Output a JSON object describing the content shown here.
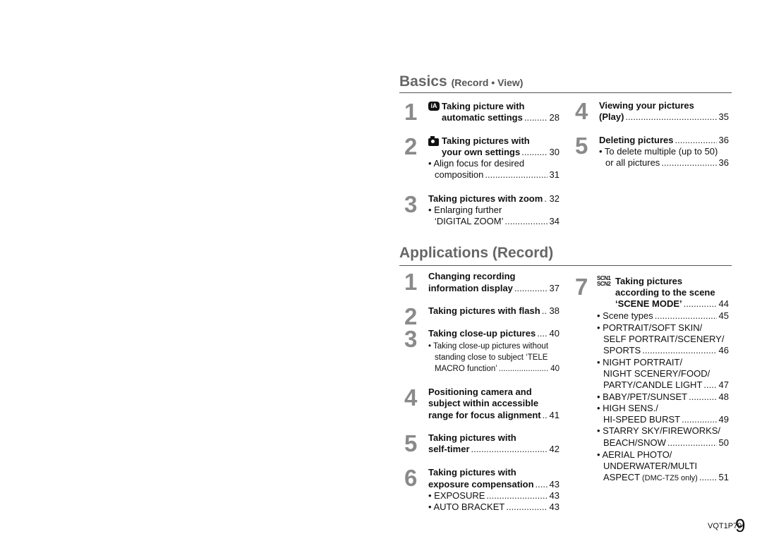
{
  "basics": {
    "title": "Basics",
    "subtitle": "(Record • View)",
    "items": [
      {
        "num": "1",
        "icon": "intelligent-auto-icon",
        "icon_text": "iA",
        "lines": [
          {
            "t": "Taking picture with",
            "b": true
          },
          {
            "t": "automatic settings",
            "p": "28",
            "b": true
          }
        ]
      },
      {
        "num": "2",
        "icon": "camera-icon",
        "lines": [
          {
            "t": "Taking pictures with",
            "b": true
          },
          {
            "t": "your own settings",
            "p": "30",
            "b": true
          },
          {
            "t": "• Align focus for desired"
          },
          {
            "t": "composition",
            "p": "31"
          }
        ]
      },
      {
        "num": "3",
        "lines": [
          {
            "t": "Taking pictures with zoom",
            "p": "32",
            "b": true
          },
          {
            "t": "• Enlarging further"
          },
          {
            "t": "‘DIGITAL ZOOM’",
            "p": "34"
          }
        ]
      },
      {
        "num": "4",
        "lines": [
          {
            "t": "Viewing your pictures",
            "b": true
          },
          {
            "t": "(Play)",
            "p": "35",
            "b": true
          }
        ]
      },
      {
        "num": "5",
        "lines": [
          {
            "t": "Deleting pictures",
            "p": "36",
            "b": true
          },
          {
            "t": "• To delete multiple (up to 50)"
          },
          {
            "t": "or all pictures",
            "p": "36"
          }
        ]
      }
    ]
  },
  "applications": {
    "title": "Applications (Record)",
    "items": [
      {
        "num": "1",
        "lines": [
          {
            "t": "Changing recording",
            "b": true
          },
          {
            "t": "information display",
            "p": "37",
            "b": true
          }
        ]
      },
      {
        "num": "2",
        "lines": [
          {
            "t": "Taking pictures with flash",
            "p": "38",
            "b": true
          }
        ]
      },
      {
        "num": "3",
        "lines": [
          {
            "t": "Taking close-up pictures",
            "p": "40",
            "b": true
          },
          {
            "t": "• Taking close-up pictures without",
            "s": true
          },
          {
            "t": "standing close to subject ‘TELE",
            "s": true
          },
          {
            "t": "MACRO function’",
            "p": "40",
            "s": true
          }
        ]
      },
      {
        "num": "4",
        "lines": [
          {
            "t": "Positioning camera and",
            "b": true
          },
          {
            "t": "subject within accessible",
            "b": true
          },
          {
            "t": "range for focus alignment",
            "p": "41",
            "b": true
          }
        ]
      },
      {
        "num": "5",
        "lines": [
          {
            "t": "Taking pictures with",
            "b": true
          },
          {
            "t": "self-timer",
            "p": "42",
            "b": true
          }
        ]
      },
      {
        "num": "6",
        "lines": [
          {
            "t": "Taking pictures with",
            "b": true
          },
          {
            "t": "exposure compensation",
            "p": "43",
            "b": true
          },
          {
            "t": "• EXPOSURE",
            "p": "43"
          },
          {
            "t": "• AUTO BRACKET",
            "p": "43"
          }
        ]
      },
      {
        "num": "7",
        "icon": "scene-mode-icon",
        "icon_text": "SCN1 SCN2",
        "lines": [
          {
            "t": "Taking pictures",
            "b": true
          },
          {
            "t": "according to the scene",
            "b": true
          },
          {
            "t": "‘SCENE MODE’",
            "p": "44",
            "b": true
          },
          {
            "t": "• Scene types",
            "p": "45"
          },
          {
            "t": "• PORTRAIT/SOFT SKIN/"
          },
          {
            "t": "SELF PORTRAIT/SCENERY/"
          },
          {
            "t": "SPORTS",
            "p": "46"
          },
          {
            "t": "• NIGHT PORTRAIT/"
          },
          {
            "t": "NIGHT SCENERY/FOOD/"
          },
          {
            "t": "PARTY/CANDLE LIGHT",
            "p": "47"
          },
          {
            "t": "• BABY/PET/SUNSET",
            "p": "48"
          },
          {
            "t": "• HIGH SENS./"
          },
          {
            "t": "HI-SPEED BURST",
            "p": "49"
          },
          {
            "t": "• STARRY SKY/FIREWORKS/"
          },
          {
            "t": "BEACH/SNOW",
            "p": "50"
          },
          {
            "t": "• AERIAL PHOTO/"
          },
          {
            "t": "UNDERWATER/MULTI"
          },
          {
            "t": "ASPECT",
            "note": "(DMC-TZ5 only)",
            "p": "51"
          }
        ]
      }
    ]
  },
  "footer": {
    "code": "VQT1P79",
    "page": "9"
  }
}
